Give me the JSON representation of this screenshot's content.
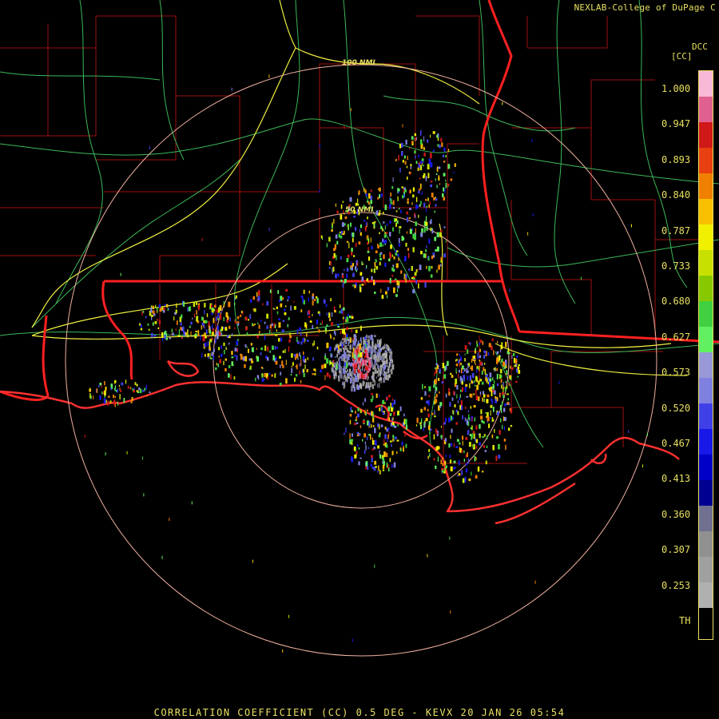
{
  "credit": "NEXLAB-College of DuPage C",
  "product_code": "DCC",
  "units": "[CC]",
  "caption": "CORRELATION COEFFICIENT (CC) 0.5 DEG - KEVX 20 JAN 26 05:54",
  "range_rings": [
    {
      "label": "100 NMI"
    },
    {
      "label": "50 NMI"
    }
  ],
  "scale": {
    "ticks": [
      "1.000",
      "0.947",
      "0.893",
      "0.840",
      "0.787",
      "0.733",
      "0.680",
      "0.627",
      "0.573",
      "0.520",
      "0.467",
      "0.413",
      "0.360",
      "0.307",
      "0.253",
      "TH"
    ],
    "colors": [
      "#f8b8d8",
      "#e06090",
      "#d01818",
      "#e84010",
      "#f08000",
      "#f8c000",
      "#f0f000",
      "#c8e000",
      "#88c800",
      "#40d040",
      "#60f060",
      "#9898d8",
      "#8080e0",
      "#4040e8",
      "#1818e8",
      "#0000c8",
      "#000090",
      "#707090",
      "#909090",
      "#a0a0a0",
      "#b0b0b0",
      "#000000"
    ]
  },
  "colors": {
    "state_border": "#ff2020",
    "county_border": "#b01010",
    "highway": "#ffff40",
    "road": "#40c060",
    "ring": "#f0b0a0",
    "text": "#e8e060"
  }
}
